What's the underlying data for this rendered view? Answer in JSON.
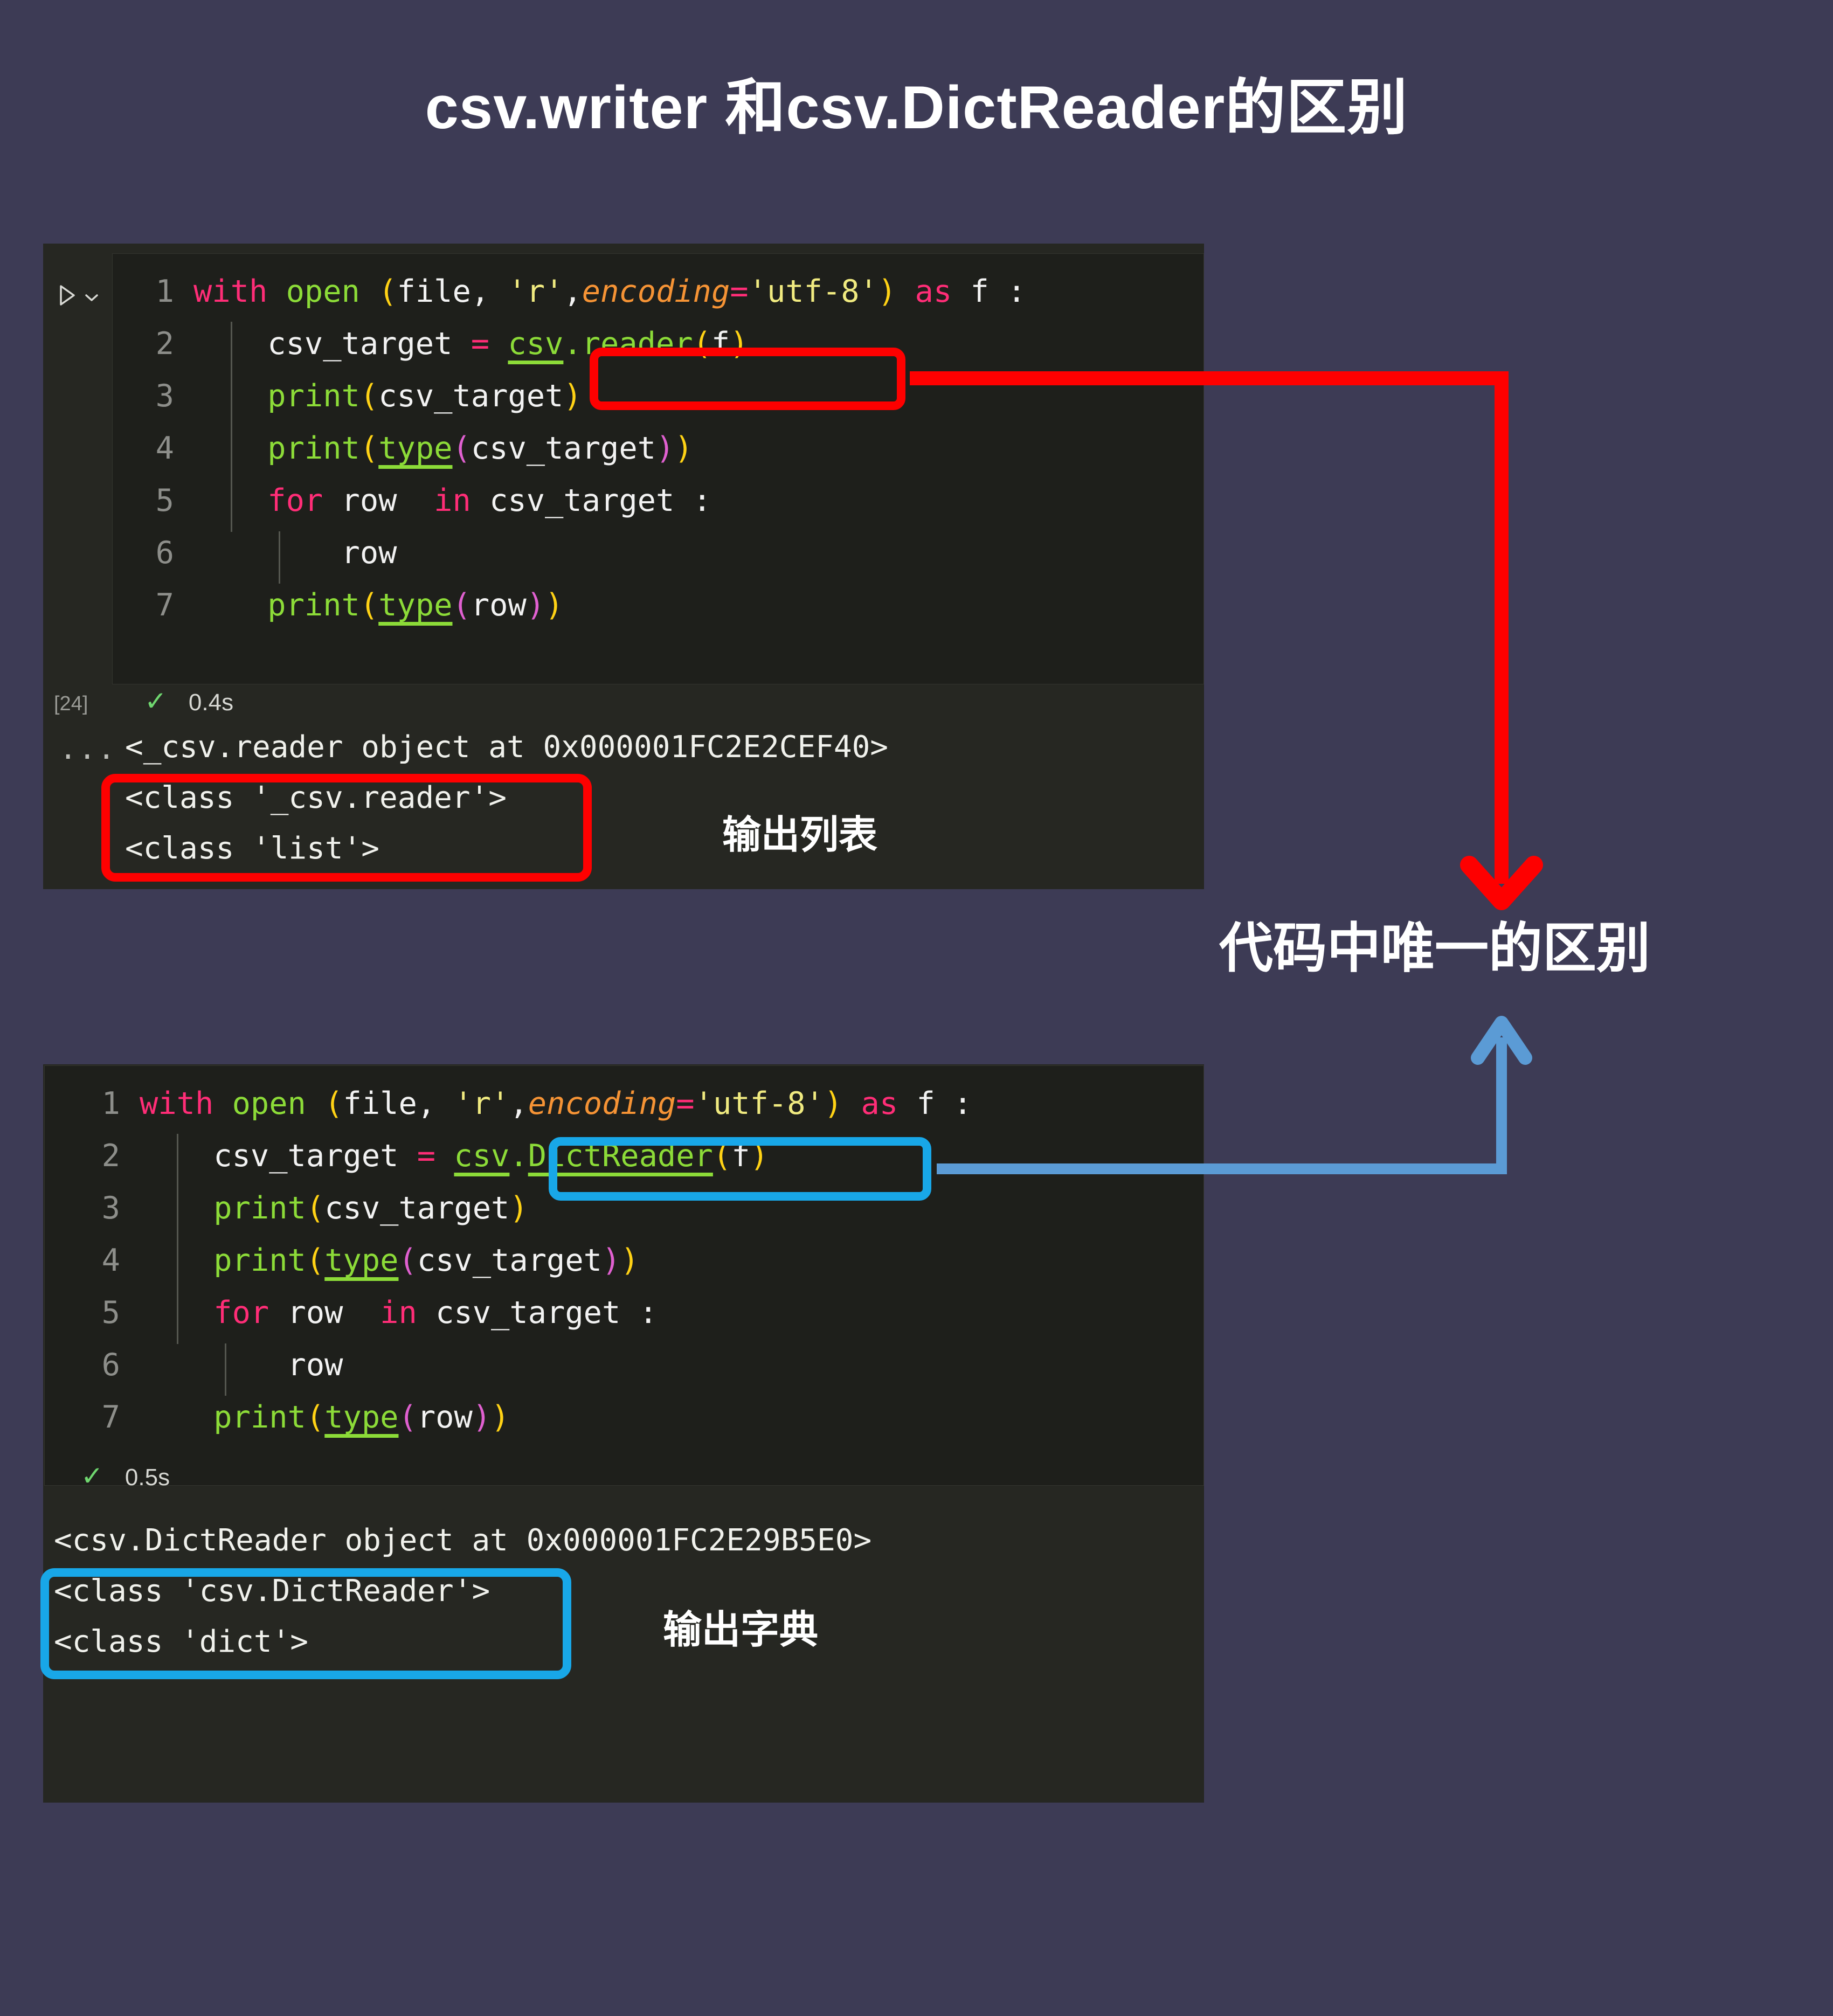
{
  "page": {
    "title": "csv.writer 和csv.DictReader的区别",
    "background_color": "#3d3b55"
  },
  "annotation": {
    "text": "代码中唯一的区别",
    "red_arrow_color": "#fe0000",
    "blue_arrow_color": "#5b9bd5"
  },
  "cell_one": {
    "run_icon": "play-icon",
    "chevron_icon": "chevron-down-icon",
    "exec_count": "[24]",
    "status_check": "✓",
    "duration": "0.4s",
    "ellipsis": "...",
    "highlight_color": "#fe0000",
    "code": [
      {
        "num": "1",
        "tokens": [
          {
            "t": "with",
            "c": "kw"
          },
          {
            "t": " ",
            "c": "txt"
          },
          {
            "t": "open",
            "c": "fn"
          },
          {
            "t": " ",
            "c": "txt"
          },
          {
            "t": "(",
            "c": "par"
          },
          {
            "t": "file",
            "c": "txt"
          },
          {
            "t": ", ",
            "c": "txt"
          },
          {
            "t": "'r'",
            "c": "str"
          },
          {
            "t": ",",
            "c": "txt"
          },
          {
            "t": "encoding",
            "c": "arg"
          },
          {
            "t": "=",
            "c": "eq"
          },
          {
            "t": "'utf-8'",
            "c": "str"
          },
          {
            "t": ")",
            "c": "par"
          },
          {
            "t": " ",
            "c": "txt"
          },
          {
            "t": "as",
            "c": "kw"
          },
          {
            "t": " f :",
            "c": "txt"
          }
        ]
      },
      {
        "num": "2",
        "tokens": [
          {
            "t": "    csv_target ",
            "c": "txt"
          },
          {
            "t": "=",
            "c": "eq"
          },
          {
            "t": " ",
            "c": "txt"
          },
          {
            "t": "csv",
            "c": "fn u"
          },
          {
            "t": ".reader",
            "c": "fn"
          },
          {
            "t": "(",
            "c": "par"
          },
          {
            "t": "f",
            "c": "txt"
          },
          {
            "t": ")",
            "c": "par"
          }
        ]
      },
      {
        "num": "3",
        "tokens": [
          {
            "t": "    ",
            "c": "txt"
          },
          {
            "t": "print",
            "c": "fn"
          },
          {
            "t": "(",
            "c": "par"
          },
          {
            "t": "csv_target",
            "c": "txt"
          },
          {
            "t": ")",
            "c": "par"
          }
        ]
      },
      {
        "num": "4",
        "tokens": [
          {
            "t": "    ",
            "c": "txt"
          },
          {
            "t": "print",
            "c": "fn"
          },
          {
            "t": "(",
            "c": "par"
          },
          {
            "t": "type",
            "c": "fn u"
          },
          {
            "t": "(",
            "c": "parm"
          },
          {
            "t": "csv_target",
            "c": "txt"
          },
          {
            "t": ")",
            "c": "parm"
          },
          {
            "t": ")",
            "c": "par"
          }
        ]
      },
      {
        "num": "5",
        "tokens": [
          {
            "t": "    ",
            "c": "txt"
          },
          {
            "t": "for",
            "c": "kw"
          },
          {
            "t": " row  ",
            "c": "txt"
          },
          {
            "t": "in",
            "c": "kw"
          },
          {
            "t": " csv_target :",
            "c": "txt"
          }
        ]
      },
      {
        "num": "6",
        "tokens": [
          {
            "t": "        row",
            "c": "txt"
          }
        ]
      },
      {
        "num": "7",
        "tokens": [
          {
            "t": "    ",
            "c": "txt"
          },
          {
            "t": "print",
            "c": "fn"
          },
          {
            "t": "(",
            "c": "par"
          },
          {
            "t": "type",
            "c": "fn u"
          },
          {
            "t": "(",
            "c": "parm"
          },
          {
            "t": "row",
            "c": "txt"
          },
          {
            "t": ")",
            "c": "parm"
          },
          {
            "t": ")",
            "c": "par"
          }
        ]
      }
    ],
    "output": [
      "<_csv.reader object at 0x000001FC2E2CEF40>",
      "<class '_csv.reader'>",
      "<class 'list'>"
    ],
    "output_label": "输出列表"
  },
  "cell_two": {
    "status_check": "✓",
    "duration": "0.5s",
    "highlight_color": "#18a7e8",
    "code": [
      {
        "num": "1",
        "tokens": [
          {
            "t": "with",
            "c": "kw"
          },
          {
            "t": " ",
            "c": "txt"
          },
          {
            "t": "open",
            "c": "fn"
          },
          {
            "t": " ",
            "c": "txt"
          },
          {
            "t": "(",
            "c": "par"
          },
          {
            "t": "file",
            "c": "txt"
          },
          {
            "t": ", ",
            "c": "txt"
          },
          {
            "t": "'r'",
            "c": "str"
          },
          {
            "t": ",",
            "c": "txt"
          },
          {
            "t": "encoding",
            "c": "arg"
          },
          {
            "t": "=",
            "c": "eq"
          },
          {
            "t": "'utf-8'",
            "c": "str"
          },
          {
            "t": ")",
            "c": "par"
          },
          {
            "t": " ",
            "c": "txt"
          },
          {
            "t": "as",
            "c": "kw"
          },
          {
            "t": " f :",
            "c": "txt"
          }
        ]
      },
      {
        "num": "2",
        "tokens": [
          {
            "t": "    csv_target ",
            "c": "txt"
          },
          {
            "t": "=",
            "c": "eq"
          },
          {
            "t": " ",
            "c": "txt"
          },
          {
            "t": "csv",
            "c": "fn u"
          },
          {
            "t": ".",
            "c": "fn"
          },
          {
            "t": "DictReader",
            "c": "fn u"
          },
          {
            "t": "(",
            "c": "par"
          },
          {
            "t": "f",
            "c": "txt"
          },
          {
            "t": ")",
            "c": "par"
          }
        ]
      },
      {
        "num": "3",
        "tokens": [
          {
            "t": "    ",
            "c": "txt"
          },
          {
            "t": "print",
            "c": "fn"
          },
          {
            "t": "(",
            "c": "par"
          },
          {
            "t": "csv_target",
            "c": "txt"
          },
          {
            "t": ")",
            "c": "par"
          }
        ]
      },
      {
        "num": "4",
        "tokens": [
          {
            "t": "    ",
            "c": "txt"
          },
          {
            "t": "print",
            "c": "fn"
          },
          {
            "t": "(",
            "c": "par"
          },
          {
            "t": "type",
            "c": "fn u"
          },
          {
            "t": "(",
            "c": "parm"
          },
          {
            "t": "csv_target",
            "c": "txt"
          },
          {
            "t": ")",
            "c": "parm"
          },
          {
            "t": ")",
            "c": "par"
          }
        ]
      },
      {
        "num": "5",
        "tokens": [
          {
            "t": "    ",
            "c": "txt"
          },
          {
            "t": "for",
            "c": "kw"
          },
          {
            "t": " row  ",
            "c": "txt"
          },
          {
            "t": "in",
            "c": "kw"
          },
          {
            "t": " csv_target :",
            "c": "txt"
          }
        ]
      },
      {
        "num": "6",
        "tokens": [
          {
            "t": "        row",
            "c": "txt"
          }
        ]
      },
      {
        "num": "7",
        "tokens": [
          {
            "t": "    ",
            "c": "txt"
          },
          {
            "t": "print",
            "c": "fn"
          },
          {
            "t": "(",
            "c": "par"
          },
          {
            "t": "type",
            "c": "fn u"
          },
          {
            "t": "(",
            "c": "parm"
          },
          {
            "t": "row",
            "c": "txt"
          },
          {
            "t": ")",
            "c": "parm"
          },
          {
            "t": ")",
            "c": "par"
          }
        ]
      }
    ],
    "output": [
      "<csv.DictReader object at 0x000001FC2E29B5E0>",
      "<class 'csv.DictReader'>",
      "<class 'dict'>"
    ],
    "output_label": "输出字典"
  }
}
